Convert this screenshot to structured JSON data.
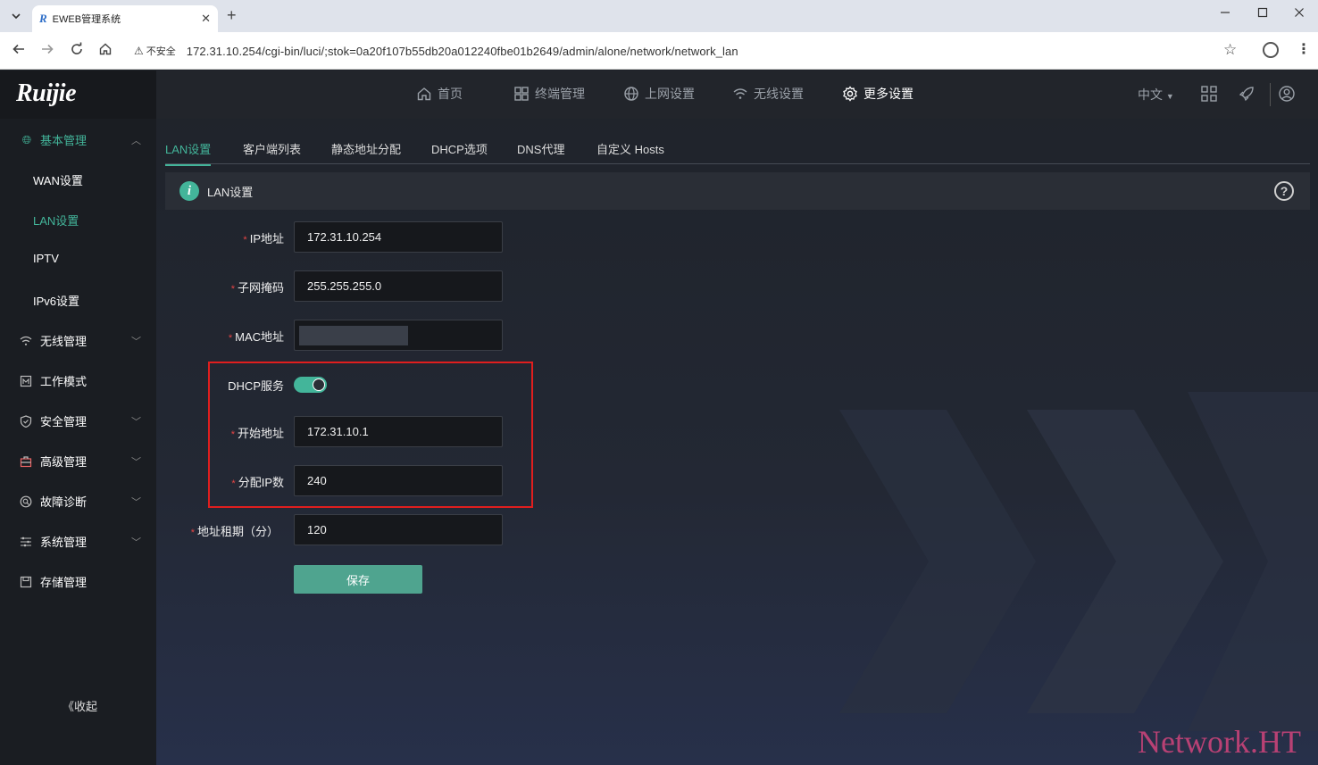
{
  "browser": {
    "tab_title": "EWEB管理系统",
    "favicon_text": "R",
    "new_tab": "+",
    "insecure_label": "不安全",
    "url": "172.31.10.254/cgi-bin/luci/;stok=0a20f107b55db20a012240fbe01b2649/admin/alone/network/network_lan"
  },
  "app": {
    "logo": "Ruijie",
    "nav": {
      "home": "首页",
      "terminal": "终端管理",
      "internet": "上网设置",
      "wireless": "无线设置",
      "more": "更多设置"
    },
    "lang": "中文",
    "sidebar": {
      "basic": "基本管理",
      "wan": "WAN设置",
      "lan": "LAN设置",
      "iptv": "IPTV",
      "ipv6": "IPv6设置",
      "wireless": "无线管理",
      "workmode": "工作模式",
      "security": "安全管理",
      "advanced": "高级管理",
      "diagnose": "故障诊断",
      "system": "系统管理",
      "storage": "存储管理",
      "collapse": "《收起"
    },
    "subtabs": {
      "lan": "LAN设置",
      "clients": "客户端列表",
      "static": "静态地址分配",
      "dhcp": "DHCP选项",
      "dns": "DNS代理",
      "hosts": "自定义 Hosts"
    },
    "section_title": "LAN设置",
    "form": {
      "ip_label": "IP地址",
      "ip_value": "172.31.10.254",
      "mask_label": "子网掩码",
      "mask_value": "255.255.255.0",
      "mac_label": "MAC地址",
      "dhcp_label": "DHCP服务",
      "dhcp_enabled": true,
      "start_label": "开始地址",
      "start_value": "172.31.10.1",
      "count_label": "分配IP数",
      "count_value": "240",
      "lease_label": "地址租期（分）",
      "lease_value": "120",
      "save": "保存",
      "required_mark": "*"
    }
  },
  "watermark": "Network.HT",
  "colors": {
    "accent": "#43b59a",
    "highlight": "#e01e1e",
    "required": "#e54545"
  }
}
